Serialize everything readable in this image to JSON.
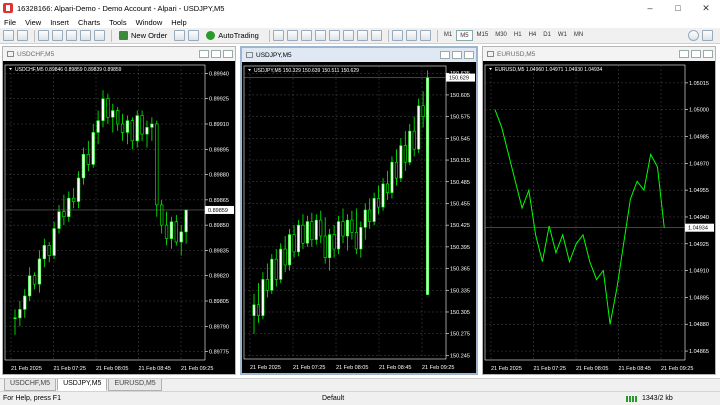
{
  "window": {
    "title": "16328166: Alpari-Demo - Demo Account - Alpari - USDJPY,M5"
  },
  "menu": [
    "File",
    "View",
    "Insert",
    "Charts",
    "Tools",
    "Window",
    "Help"
  ],
  "toolbar": {
    "new_order_label": "New Order",
    "autotrading_label": "AutoTrading",
    "timeframes": [
      "M1",
      "M5",
      "M15",
      "M30",
      "H1",
      "H4",
      "D1",
      "W1",
      "MN"
    ],
    "active_timeframe": "M5"
  },
  "charts": [
    {
      "window_title": "USDCHF,M5",
      "info_line": "USDCHF,M5  0.89846 0.89859 0.89839 0.89859",
      "y_ticks": [
        "0.89940",
        "0.89925",
        "0.89910",
        "0.89895",
        "0.89880",
        "0.89865",
        "0.89850",
        "0.89835",
        "0.89820",
        "0.89805",
        "0.89790",
        "0.89775"
      ],
      "current_price": "0.89859",
      "x_ticks": [
        "21 Feb 2025",
        "21 Feb 07:25",
        "21 Feb 08:05",
        "21 Feb 08:45",
        "21 Feb 09:25"
      ]
    },
    {
      "window_title": "USDJPY,M5",
      "info_line": "USDJPY,M5  150.329 150.639 150.511 150.629",
      "y_ticks": [
        "150.635",
        "150.605",
        "150.575",
        "150.545",
        "150.515",
        "150.485",
        "150.455",
        "150.425",
        "150.395",
        "150.365",
        "150.335",
        "150.305",
        "150.275",
        "150.245"
      ],
      "current_price": "150.629",
      "x_ticks": [
        "21 Feb 2025",
        "21 Feb 07:25",
        "21 Feb 08:05",
        "21 Feb 08:45",
        "21 Feb 09:25"
      ]
    },
    {
      "window_title": "EURUSD,M5",
      "info_line": "EURUSD,M5  1.04960 1.04971 1.04930 1.04934",
      "y_ticks": [
        "1.05015",
        "1.05000",
        "1.04985",
        "1.04970",
        "1.04955",
        "1.04940",
        "1.04925",
        "1.04910",
        "1.04895",
        "1.04880",
        "1.04865"
      ],
      "current_price": "1.04934",
      "x_ticks": [
        "21 Feb 2025",
        "21 Feb 07:25",
        "21 Feb 08:05",
        "21 Feb 08:45",
        "21 Feb 09:25"
      ]
    }
  ],
  "chart_data": [
    {
      "type": "candlestick",
      "symbol": "USDCHF,M5",
      "ylim": [
        0.8977,
        0.89945
      ],
      "ohlc": [
        [
          0.89795,
          0.898,
          0.89785,
          0.89795
        ],
        [
          0.89795,
          0.89805,
          0.8979,
          0.898
        ],
        [
          0.898,
          0.89812,
          0.89795,
          0.89808
        ],
        [
          0.89808,
          0.89825,
          0.89805,
          0.8982
        ],
        [
          0.8982,
          0.89822,
          0.89812,
          0.89815
        ],
        [
          0.89815,
          0.89835,
          0.8981,
          0.8983
        ],
        [
          0.8983,
          0.89842,
          0.89825,
          0.89838
        ],
        [
          0.89838,
          0.8984,
          0.89828,
          0.89832
        ],
        [
          0.89832,
          0.89852,
          0.8983,
          0.89848
        ],
        [
          0.89848,
          0.89862,
          0.89845,
          0.89858
        ],
        [
          0.89858,
          0.89868,
          0.8985,
          0.89855
        ],
        [
          0.89855,
          0.8987,
          0.89852,
          0.89866
        ],
        [
          0.89866,
          0.89872,
          0.8986,
          0.89864
        ],
        [
          0.89864,
          0.89882,
          0.8986,
          0.89878
        ],
        [
          0.89878,
          0.89896,
          0.89874,
          0.89892
        ],
        [
          0.89892,
          0.899,
          0.89882,
          0.89886
        ],
        [
          0.89886,
          0.8991,
          0.89884,
          0.89905
        ],
        [
          0.89905,
          0.89918,
          0.89898,
          0.89912
        ],
        [
          0.89912,
          0.8993,
          0.89908,
          0.89925
        ],
        [
          0.89925,
          0.89928,
          0.8991,
          0.89914
        ],
        [
          0.89914,
          0.89922,
          0.89905,
          0.89918
        ],
        [
          0.89918,
          0.8992,
          0.89906,
          0.8991
        ],
        [
          0.8991,
          0.89916,
          0.899,
          0.89905
        ],
        [
          0.89905,
          0.89915,
          0.89898,
          0.89912
        ],
        [
          0.89912,
          0.89914,
          0.89895,
          0.899
        ],
        [
          0.899,
          0.89918,
          0.89896,
          0.89915
        ],
        [
          0.89915,
          0.89918,
          0.899,
          0.89904
        ],
        [
          0.89904,
          0.89912,
          0.89896,
          0.89908
        ],
        [
          0.89908,
          0.89914,
          0.899,
          0.8991
        ],
        [
          0.8991,
          0.89912,
          0.89855,
          0.89862
        ],
        [
          0.89862,
          0.89865,
          0.89845,
          0.8985
        ],
        [
          0.8985,
          0.89858,
          0.89838,
          0.89842
        ],
        [
          0.89842,
          0.89855,
          0.89836,
          0.89852
        ],
        [
          0.89852,
          0.89856,
          0.89838,
          0.8984
        ],
        [
          0.8984,
          0.8985,
          0.89832,
          0.89846
        ],
        [
          0.89846,
          0.89859,
          0.89839,
          0.89859
        ]
      ]
    },
    {
      "type": "candlestick",
      "symbol": "USDJPY,M5",
      "ylim": [
        150.24,
        150.645
      ],
      "ohlc": [
        [
          150.3,
          150.33,
          150.275,
          150.315
        ],
        [
          150.315,
          150.345,
          150.29,
          150.3
        ],
        [
          150.3,
          150.36,
          150.295,
          150.35
        ],
        [
          150.35,
          150.372,
          150.325,
          150.335
        ],
        [
          150.335,
          150.385,
          150.33,
          150.378
        ],
        [
          150.378,
          150.392,
          150.34,
          150.35
        ],
        [
          150.35,
          150.4,
          150.345,
          150.392
        ],
        [
          150.392,
          150.41,
          150.36,
          150.37
        ],
        [
          150.37,
          150.42,
          150.362,
          150.412
        ],
        [
          150.412,
          150.425,
          150.38,
          150.388
        ],
        [
          150.388,
          150.432,
          150.382,
          150.425
        ],
        [
          150.425,
          150.44,
          150.392,
          150.4
        ],
        [
          150.4,
          150.438,
          150.395,
          150.43
        ],
        [
          150.43,
          150.442,
          150.395,
          150.405
        ],
        [
          150.405,
          150.44,
          150.398,
          150.432
        ],
        [
          150.432,
          150.445,
          150.4,
          150.41
        ],
        [
          150.41,
          150.436,
          150.372,
          150.38
        ],
        [
          150.38,
          150.42,
          150.362,
          150.412
        ],
        [
          150.412,
          150.425,
          150.38,
          150.392
        ],
        [
          150.392,
          150.438,
          150.385,
          150.43
        ],
        [
          150.43,
          150.448,
          150.4,
          150.41
        ],
        [
          150.41,
          150.44,
          150.39,
          150.432
        ],
        [
          150.432,
          150.445,
          150.405,
          150.415
        ],
        [
          150.415,
          150.448,
          150.385,
          150.392
        ],
        [
          150.392,
          150.43,
          150.38,
          150.422
        ],
        [
          150.422,
          150.455,
          150.405,
          150.446
        ],
        [
          150.446,
          150.462,
          150.42,
          150.43
        ],
        [
          150.43,
          150.47,
          150.425,
          150.462
        ],
        [
          150.462,
          150.48,
          150.44,
          150.45
        ],
        [
          150.45,
          150.49,
          150.445,
          150.482
        ],
        [
          150.482,
          150.5,
          150.46,
          150.47
        ],
        [
          150.47,
          150.52,
          150.462,
          150.512
        ],
        [
          150.512,
          150.53,
          150.48,
          150.49
        ],
        [
          150.49,
          150.545,
          150.485,
          150.535
        ],
        [
          150.535,
          150.555,
          150.5,
          150.512
        ],
        [
          150.512,
          150.565,
          150.508,
          150.555
        ],
        [
          150.555,
          150.575,
          150.52,
          150.53
        ],
        [
          150.53,
          150.6,
          150.525,
          150.59
        ],
        [
          150.59,
          150.61,
          150.56,
          150.575
        ],
        [
          150.329,
          150.639,
          150.511,
          150.629
        ]
      ]
    },
    {
      "type": "line",
      "symbol": "EURUSD,M5",
      "ylim": [
        1.0486,
        1.05025
      ],
      "values": [
        1.05,
        1.0499,
        1.04975,
        1.0496,
        1.04945,
        1.04955,
        1.0493,
        1.04915,
        1.04935,
        1.0492,
        1.0493,
        1.04915,
        1.04925,
        1.0493,
        1.04915,
        1.04905,
        1.0491,
        1.0488,
        1.049,
        1.04925,
        1.0495,
        1.0496,
        1.04955,
        1.04975,
        1.04968,
        1.04934
      ]
    }
  ],
  "tabs": [
    "USDCHF,M5",
    "USDJPY,M5",
    "EURUSD,M5"
  ],
  "active_tab": "USDJPY,M5",
  "status": {
    "help_text": "For Help, press F1",
    "profile": "Default",
    "traffic": "1343/2 kb"
  },
  "colors": {
    "chart_bg": "#000000",
    "candle_bull": "#ffffff",
    "candle_bear": "#000000",
    "candle_line": "#00ff00",
    "grid": "#4a4a4a",
    "axis_text": "#ffffff",
    "price_tag_bg": "#ffffff"
  },
  "icons": [
    "new-chart-icon",
    "profiles-icon",
    "market-watch-icon",
    "navigator-icon",
    "terminal-icon",
    "strategy-tester-icon",
    "zoom-in-icon",
    "zoom-out-icon",
    "tile-icon",
    "scroll-icon",
    "shift-icon",
    "indicators-icon",
    "templates-icon",
    "periods-icon",
    "search-icon",
    "chat-icon"
  ]
}
